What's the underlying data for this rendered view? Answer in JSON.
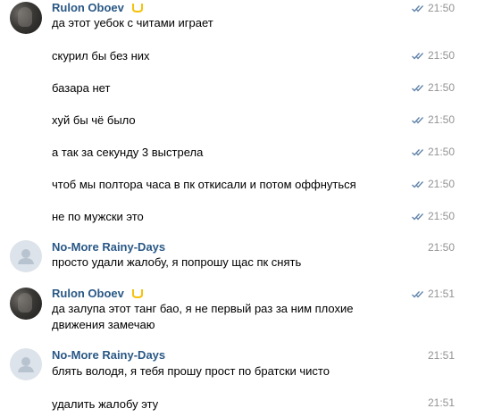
{
  "colors": {
    "author": "#2a5885",
    "time": "#939393",
    "check": "#5e81a8",
    "crown": "#f5c20b"
  },
  "messages": [
    {
      "author": "Rulon Oboev",
      "avatar": "photo",
      "badge": "crown-icon",
      "text": "да этот уебок с читами играет",
      "time": "21:50",
      "read": true
    },
    {
      "text": "скурил бы без них",
      "time": "21:50",
      "read": true
    },
    {
      "text": "базара нет",
      "time": "21:50",
      "read": true
    },
    {
      "text": "хуй бы чё было",
      "time": "21:50",
      "read": true
    },
    {
      "text": "а так за секунду 3 выстрела",
      "time": "21:50",
      "read": true
    },
    {
      "text": "чтоб мы полтора часа в пк откисали и потом оффнуться",
      "time": "21:50",
      "read": true
    },
    {
      "text": "не по мужски это",
      "time": "21:50",
      "read": true
    },
    {
      "author": "No-More Rainy-Days",
      "avatar": "default",
      "text": "просто удали жалобу, я попрошу щас пк снять",
      "time": "21:50",
      "read": false
    },
    {
      "author": "Rulon Oboev",
      "avatar": "photo",
      "badge": "crown-icon",
      "text_lines": [
        "да залупа этот танг бао, я не первый раз за ним плохие",
        "движения замечаю"
      ],
      "time": "21:51",
      "read": true
    },
    {
      "author": "No-More Rainy-Days",
      "avatar": "default",
      "text": "блять володя, я тебя прошу прост по братски чисто",
      "time": "21:51",
      "read": false
    },
    {
      "text": "удалить жалобу эту",
      "time": "21:51",
      "read": false
    }
  ]
}
